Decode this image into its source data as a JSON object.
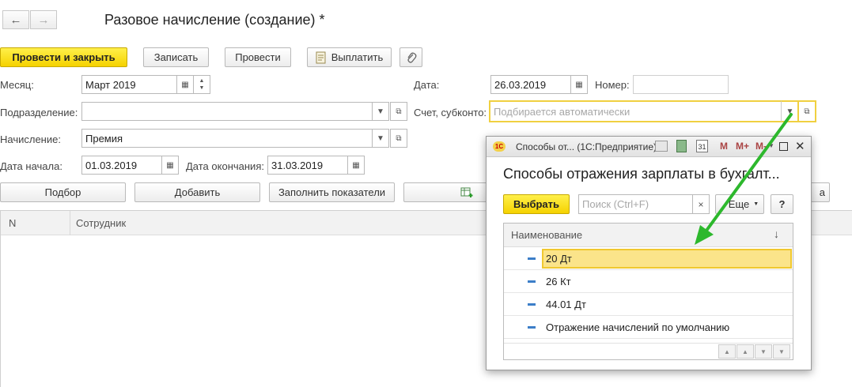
{
  "window": {
    "title": "Разовое начисление (создание) *",
    "back_icon": "arrow-left-icon",
    "forward_icon": "arrow-right-icon"
  },
  "toolbar": {
    "post_close": "Провести и закрыть",
    "save": "Записать",
    "post": "Провести",
    "pay": "Выплатить",
    "attach_icon": "paperclip-icon"
  },
  "form": {
    "month_label": "Месяц:",
    "month_value": "Март 2019",
    "date_label": "Дата:",
    "date_value": "26.03.2019",
    "number_label": "Номер:",
    "number_value": "",
    "division_label": "Подразделение:",
    "division_value": "",
    "account_label": "Счет, субконто:",
    "account_placeholder": "Подбирается автоматически",
    "accrual_label": "Начисление:",
    "accrual_value": "Премия",
    "start_label": "Дата начала:",
    "start_value": "01.03.2019",
    "end_label": "Дата окончания:",
    "end_value": "31.03.2019"
  },
  "actions": {
    "select": "Подбор",
    "add": "Добавить",
    "fill": "Заполнить показатели",
    "last_partial": "а"
  },
  "table": {
    "col_n": "N",
    "col_employee": "Сотрудник"
  },
  "popup": {
    "app_icon": "1c-logo-icon",
    "titlebar_text": "Способы от... (1С:Предприятие)",
    "heading": "Способы отражения зарплаты в бухгалт...",
    "choose_button": "Выбрать",
    "search_placeholder": "Поиск (Ctrl+F)",
    "more_button": "Еще",
    "help_button": "?",
    "column_name": "Наименование",
    "items": [
      {
        "label": "20 Дт",
        "selected": true
      },
      {
        "label": "26 Кт",
        "selected": false
      },
      {
        "label": "44.01 Дт",
        "selected": false
      },
      {
        "label": "Отражение начислений по умолчанию",
        "selected": false
      }
    ]
  },
  "colors": {
    "accent_yellow": "#f5d200",
    "selected_row": "#fbe48a",
    "arrow_green": "#2db82d",
    "focus_border": "#f0d040"
  }
}
